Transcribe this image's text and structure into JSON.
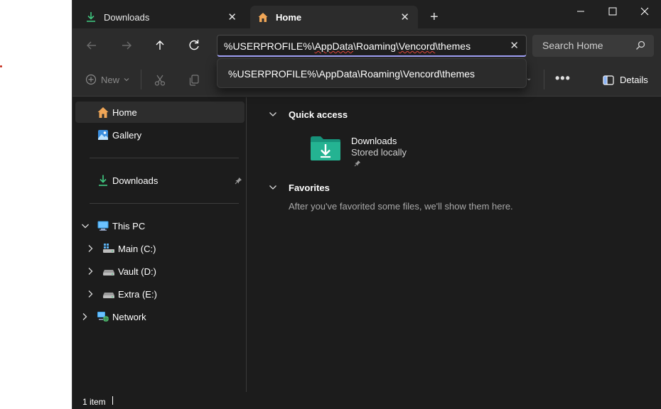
{
  "window": {
    "tabs": [
      {
        "label": "Downloads",
        "close": "✕",
        "icon": "download-icon"
      },
      {
        "label": "Home",
        "close": "✕",
        "icon": "home-icon"
      }
    ],
    "new_tab": "+",
    "controls": [
      "minimize-icon",
      "maximize-icon",
      "close-icon"
    ]
  },
  "navbar": {
    "back": "back-arrow-icon",
    "forward": "forward-arrow-icon",
    "up": "up-arrow-icon",
    "refresh": "refresh-icon",
    "address": {
      "part1": "%USERPROFILE%\\",
      "part2": "AppData",
      "part3": "\\Roaming\\",
      "part4": "Vencord",
      "part5": "\\themes",
      "clear": "✕"
    },
    "search": {
      "placeholder": "Search Home",
      "icon": "search-icon"
    }
  },
  "suggestion": {
    "text": "%USERPROFILE%\\AppData\\Roaming\\Vencord\\themes"
  },
  "commandbar": {
    "new_label": "New",
    "more": "•••",
    "details_label": "Details"
  },
  "sidebar": {
    "home": "Home",
    "gallery": "Gallery",
    "downloads": "Downloads",
    "this_pc": "This PC",
    "drives": [
      "Main (C:)",
      "Vault (D:)",
      "Extra (E:)"
    ],
    "network": "Network"
  },
  "content": {
    "quick_access": "Quick access",
    "tile": {
      "name": "Downloads",
      "sub": "Stored locally"
    },
    "favorites": "Favorites",
    "favorites_empty": "After you've favorited some files, we'll show them here."
  },
  "status": {
    "items": "1 item"
  },
  "colors": {
    "accent": "#a6a6ff",
    "folder": "#1fa98a",
    "download_green": "#3fc47e"
  }
}
